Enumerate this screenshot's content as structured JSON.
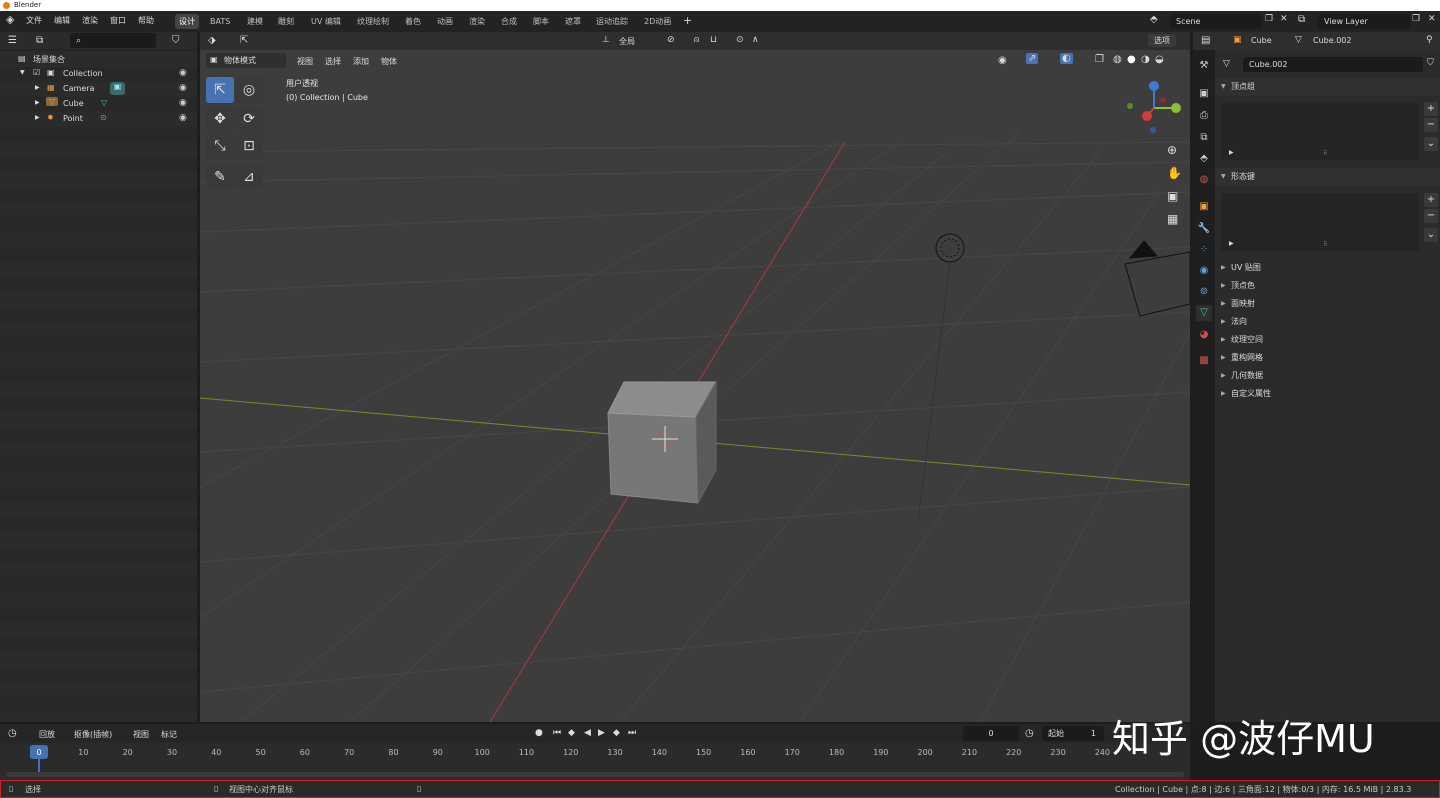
{
  "window": {
    "title": "Blender"
  },
  "menu": {
    "file": "文件",
    "edit": "编辑",
    "render": "渲染",
    "window": "窗口",
    "help": "帮助"
  },
  "workspaces": [
    "设计",
    "BATS",
    "建模",
    "雕刻",
    "UV 编辑",
    "纹理绘制",
    "着色",
    "动画",
    "渲染",
    "合成",
    "脚本",
    "遮罩",
    "运动追踪",
    "2D动画"
  ],
  "scene": {
    "name": "Scene",
    "view_layer": "View Layer"
  },
  "outliner": {
    "root": "场景集合",
    "items": [
      {
        "label": "Collection",
        "icon": "collection-icon"
      },
      {
        "label": "Camera",
        "icon": "camera-icon"
      },
      {
        "label": "Cube",
        "icon": "mesh-icon"
      },
      {
        "label": "Point",
        "icon": "light-icon"
      }
    ]
  },
  "viewport": {
    "mode": "物体模式",
    "menus": [
      "视图",
      "选择",
      "添加",
      "物体"
    ],
    "orientation": "全局",
    "options": "选项",
    "view_name": "用户透视",
    "collection_info": "(0) Collection | Cube"
  },
  "properties": {
    "object": "Cube",
    "mesh": "Cube.002",
    "data_name": "Cube.002",
    "panels_open": [
      "顶点组",
      "形态键"
    ],
    "panels_closed": [
      "UV 贴图",
      "顶点色",
      "面映射",
      "法向",
      "纹理空间",
      "重构网格",
      "几何数据",
      "自定义属性"
    ]
  },
  "timeline": {
    "menus": [
      "回放",
      "抠像(插帧)",
      "视图",
      "标记"
    ],
    "current_frame": "0",
    "start_label": "起始",
    "start_value": "1",
    "ticks": [
      "0",
      "10",
      "20",
      "30",
      "40",
      "50",
      "60",
      "70",
      "80",
      "90",
      "100",
      "110",
      "120",
      "130",
      "140",
      "150",
      "160",
      "170",
      "180",
      "190",
      "200",
      "210",
      "220",
      "230",
      "240"
    ]
  },
  "status": {
    "left": "选择",
    "middle": "视图中心对齐鼠标",
    "right": "Collection | Cube | 点:8 | 边:6 | 三角面:12 | 物体:0/3 | 内存: 16.5 MiB | 2.83.3"
  },
  "watermark": "知乎 @波仔MU",
  "colors": {
    "accent": "#4772b3",
    "x_axis": "#c03b3b",
    "y_axis": "#8a9a2b",
    "background": "#3d3d3d"
  }
}
